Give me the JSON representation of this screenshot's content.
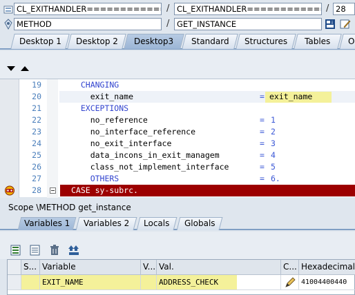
{
  "header": {
    "field1_value": "CL_EXITHANDLER===============",
    "slash1": "/",
    "field2_value": "CL_EXITHANDLER===============",
    "slash2": "/",
    "line_value": "28",
    "field3_value": "METHOD",
    "slash3": "/",
    "field4_value": "GET_INSTANCE"
  },
  "desktop_tabs": [
    "Desktop 1",
    "Desktop 2",
    "Desktop3",
    "Standard",
    "Structures",
    "Tables",
    "O"
  ],
  "code_lines": [
    {
      "no": "19",
      "text": "  CHANGING",
      "eq": "",
      "val": ""
    },
    {
      "no": "20",
      "text": "    exit_name",
      "eq": "=",
      "val": "exit_name"
    },
    {
      "no": "21",
      "text": "  EXCEPTIONS",
      "eq": "",
      "val": ""
    },
    {
      "no": "22",
      "text": "    no_reference",
      "eq": "=",
      "val": "1"
    },
    {
      "no": "23",
      "text": "    no_interface_reference",
      "eq": "=",
      "val": "2"
    },
    {
      "no": "24",
      "text": "    no_exit_interface",
      "eq": "=",
      "val": "3"
    },
    {
      "no": "25",
      "text": "    data_incons_in_exit_managem",
      "eq": "=",
      "val": "4"
    },
    {
      "no": "26",
      "text": "    class_not_implement_interface",
      "eq": "=",
      "val": "5"
    },
    {
      "no": "27",
      "text": "    OTHERS",
      "eq": "=",
      "val": "6."
    },
    {
      "no": "28",
      "text": "CASE sy-subrc.",
      "eq": "",
      "val": ""
    }
  ],
  "scope_label": "Scope \\METHOD get_instance",
  "var_tabs": [
    "Variables 1",
    "Variables 2",
    "Locals",
    "Globals"
  ],
  "table": {
    "headers": [
      "S...",
      "Variable",
      "V...",
      "Val.",
      "C...",
      "Hexadecimal V"
    ],
    "row": {
      "variable": "EXIT_NAME",
      "value": "ADDRESS_CHECK",
      "hex": "41004400440"
    }
  },
  "colors": {
    "current_line": "#9c0000",
    "highlight_yellow": "#f4f19a",
    "keyword_blue": "#3244cf"
  }
}
